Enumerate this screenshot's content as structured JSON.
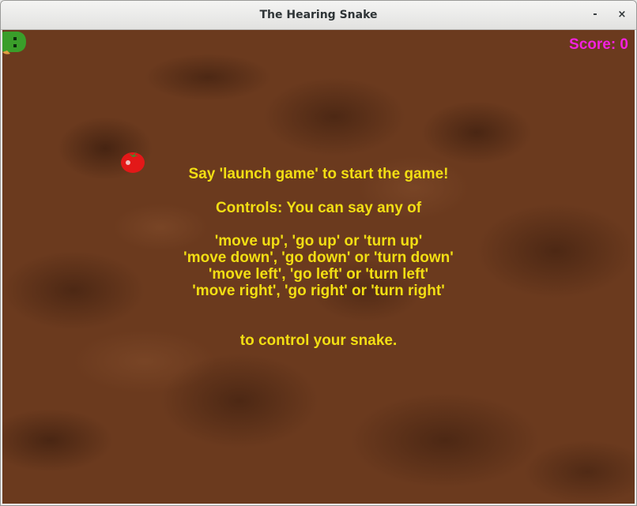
{
  "window": {
    "title": "The Hearing Snake",
    "minimize_label": "-",
    "close_label": "×"
  },
  "game": {
    "score_text": "Score: 0",
    "instructions": {
      "start": "Say 'launch game' to start the game!",
      "controls_header": "Controls: You can say any of",
      "up": "'move up', 'go up' or 'turn up'",
      "down": "'move down', 'go down' or 'turn down'",
      "left": "'move left', 'go left' or 'turn left'",
      "right": "'move right', 'go right' or 'turn right'",
      "footer": "to control your snake."
    },
    "colors": {
      "score": "#f321e0",
      "text": "#f2de13",
      "snake": "#3a9e2a",
      "apple": "#e31818"
    }
  }
}
